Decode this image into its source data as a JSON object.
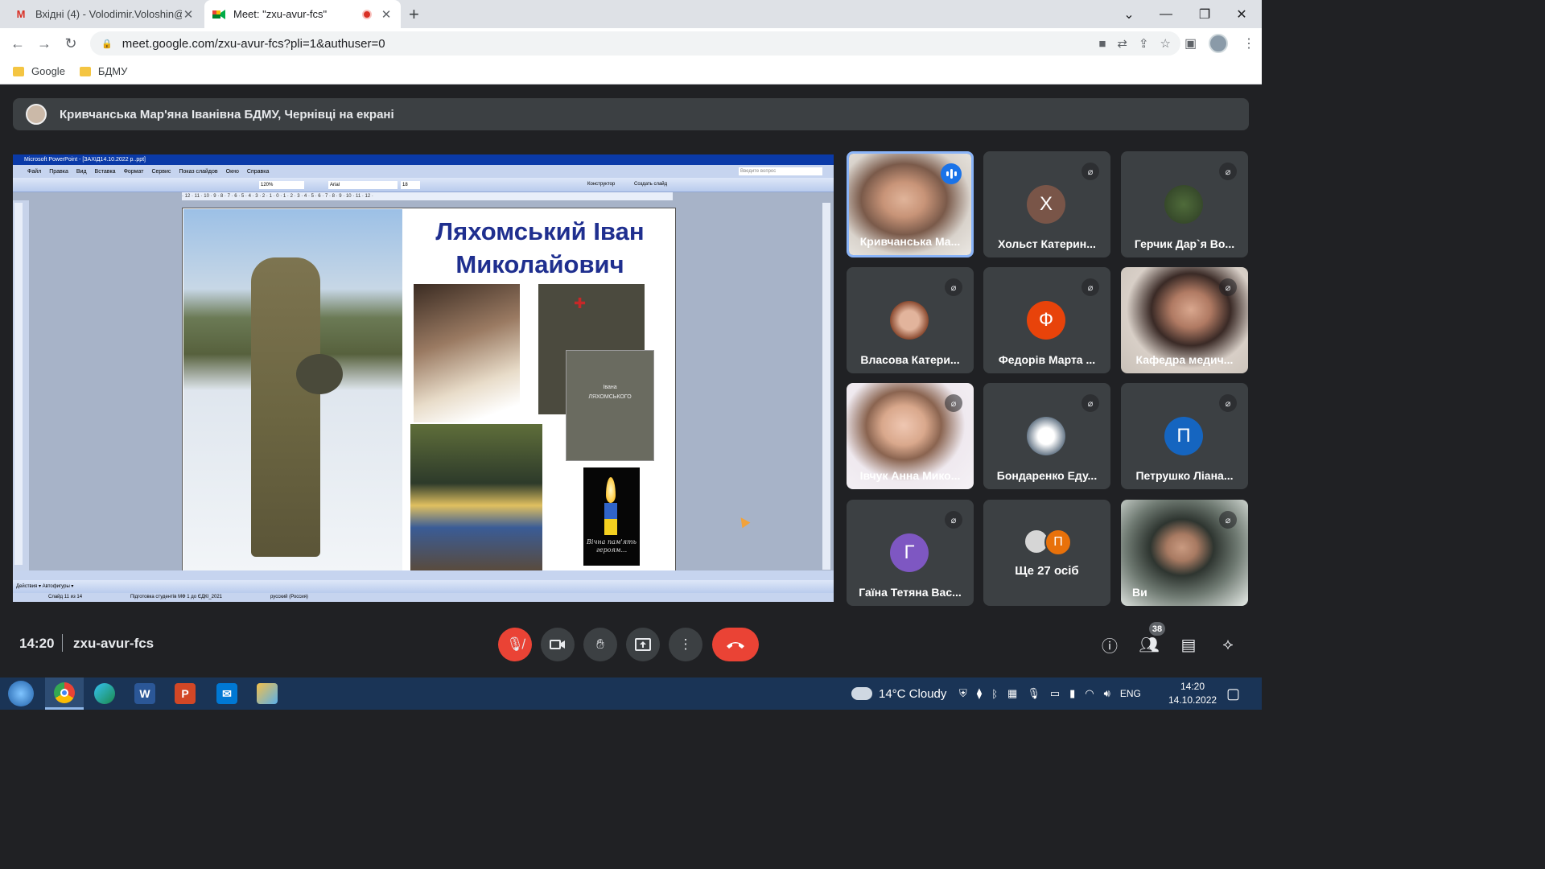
{
  "browser": {
    "tabs": [
      {
        "title": "Вхідні (4) - Volodimir.Voloshin@b",
        "favicon": "gmail-icon"
      },
      {
        "title": "Meet: \"zxu-avur-fcs\"",
        "favicon": "meet-icon"
      }
    ],
    "url": "meet.google.com/zxu-avur-fcs?pli=1&authuser=0",
    "bookmarks": [
      "Google",
      "БДМУ"
    ]
  },
  "meet": {
    "presenter_text": "Кривчанська Мар'яна Іванівна БДМУ, Чернівці на екрані",
    "time": "14:20",
    "meeting_code": "zxu-avur-fcs",
    "participant_count": "38",
    "tiles": [
      {
        "name": "Кривчанська Ма...",
        "type": "video",
        "state": "speaking"
      },
      {
        "name": "Хольст Катерин...",
        "type": "letter",
        "letter": "Х",
        "color": "#795548",
        "state": "muted"
      },
      {
        "name": "Герчик Дар`я Во...",
        "type": "photo",
        "state": "muted"
      },
      {
        "name": "Власова Катери...",
        "type": "photo",
        "state": "muted"
      },
      {
        "name": "Федорів Марта ...",
        "type": "letter",
        "letter": "Ф",
        "color": "#e8430a",
        "state": "muted"
      },
      {
        "name": "Кафедра медич...",
        "type": "video",
        "state": "muted"
      },
      {
        "name": "Івчук Анна Мико...",
        "type": "video",
        "state": "muted"
      },
      {
        "name": "Бондаренко Еду...",
        "type": "photo",
        "state": "muted"
      },
      {
        "name": "Петрушко Ліана...",
        "type": "letter",
        "letter": "П",
        "color": "#1565c0",
        "state": "muted"
      },
      {
        "name": "Гаїна Тетяна Вас...",
        "type": "letter",
        "letter": "Г",
        "color": "#7e57c2",
        "state": "muted"
      }
    ],
    "more": {
      "text": "Ще 27 осіб",
      "letter": "П"
    },
    "self_tile": {
      "name": "Ви"
    }
  },
  "shared_screen": {
    "app_title": "Microsoft PowerPoint - [ЗАХІД14.10.2022 р..ppt]",
    "menu": [
      "Файл",
      "Правка",
      "Вид",
      "Вставка",
      "Формат",
      "Сервис",
      "Показ слайдов",
      "Окно",
      "Справка"
    ],
    "ask_placeholder": "Введите вопрос",
    "zoom": "120%",
    "font": "Arial",
    "font_size": "18",
    "designer": "Конструктор",
    "new_slide": "Создать слайд",
    "draw_label": "Действия ▾   Автофигуры ▾",
    "status": [
      "Слайд 11 из 14",
      "Підготовка студентів МФ 1 до ЄДКІ_2021",
      "русский (Россия)"
    ],
    "slide": {
      "name_line1": "Ляхомський Іван",
      "name_line2": "Миколайович",
      "doc_heading": "Івана",
      "doc_name": "ЛЯХОМСЬКОГО",
      "candle_caption": "Вічна пам'ять героям..."
    }
  },
  "taskbar": {
    "apps": [
      "start-orb",
      "chrome",
      "edge",
      "word",
      "powerpoint",
      "mail",
      "paint"
    ],
    "weather": "14°C  Cloudy",
    "lang": "ENG",
    "time": "14:20",
    "date": "14.10.2022"
  }
}
